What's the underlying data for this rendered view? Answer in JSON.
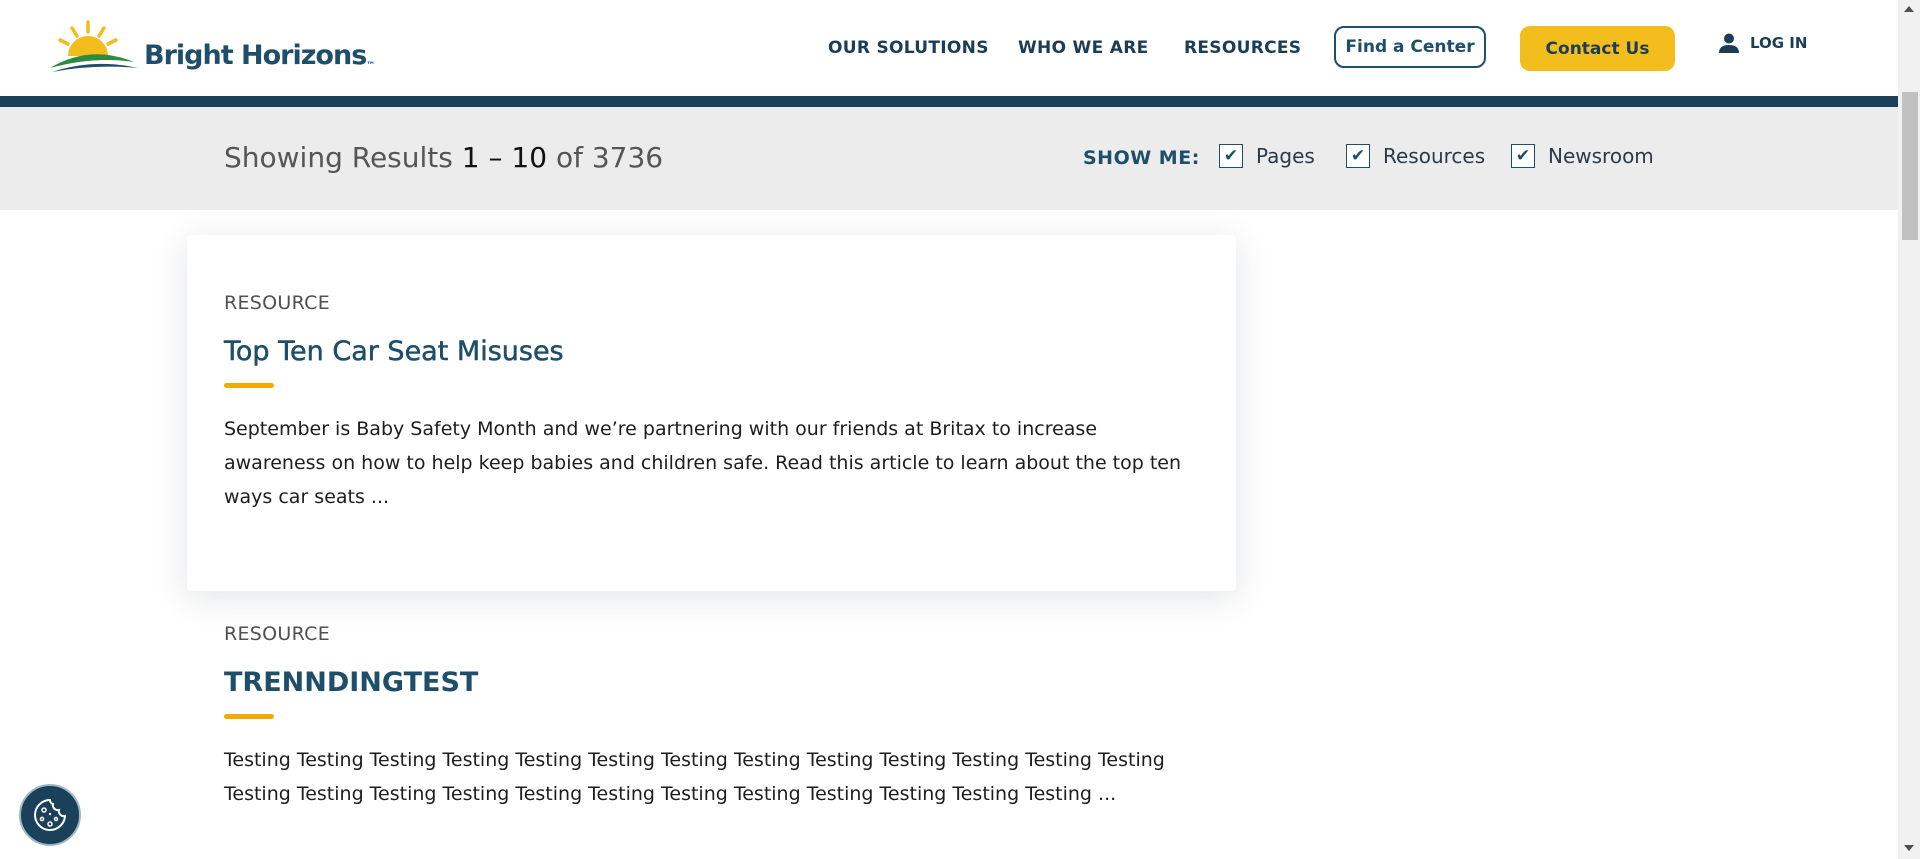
{
  "brand": {
    "name": "Bright Horizons",
    "trademark": "™",
    "colors": {
      "navy": "#1b4059",
      "yellow": "#f2bd1d",
      "accent_underline": "#f2a900",
      "title_blue": "#1f4e6b"
    }
  },
  "nav": {
    "items": [
      {
        "label": "OUR SOLUTIONS"
      },
      {
        "label": "WHO WE ARE"
      },
      {
        "label": "RESOURCES"
      }
    ],
    "find_center_label": "Find a Center",
    "contact_label": "Contact Us",
    "login_label": "LOG IN",
    "login_icon": "user-icon"
  },
  "filters": {
    "summary_prefix": "Showing Results",
    "range_start": "1",
    "range_separator": "–",
    "range_end": "10",
    "of_label": "of",
    "total": "3736",
    "show_me_label": "SHOW ME:",
    "options": [
      {
        "label": "Pages",
        "checked": true
      },
      {
        "label": "Resources",
        "checked": true
      },
      {
        "label": "Newsroom",
        "checked": true
      }
    ],
    "check_glyph": "✔"
  },
  "results": [
    {
      "type": "RESOURCE",
      "title": "Top Ten Car Seat Misuses",
      "description": "September is Baby Safety Month and we’re partnering with our friends at Britax to increase awareness on how to help keep babies and children safe. Read this article to learn about the top ten ways car seats ..."
    },
    {
      "type": "RESOURCE",
      "title": "TRENNDINGTEST",
      "description": "Testing Testing Testing Testing Testing Testing Testing Testing Testing Testing Testing Testing Testing Testing Testing Testing Testing Testing Testing Testing Testing Testing Testing Testing Testing ..."
    }
  ],
  "cookie_icon": "cookie-icon"
}
